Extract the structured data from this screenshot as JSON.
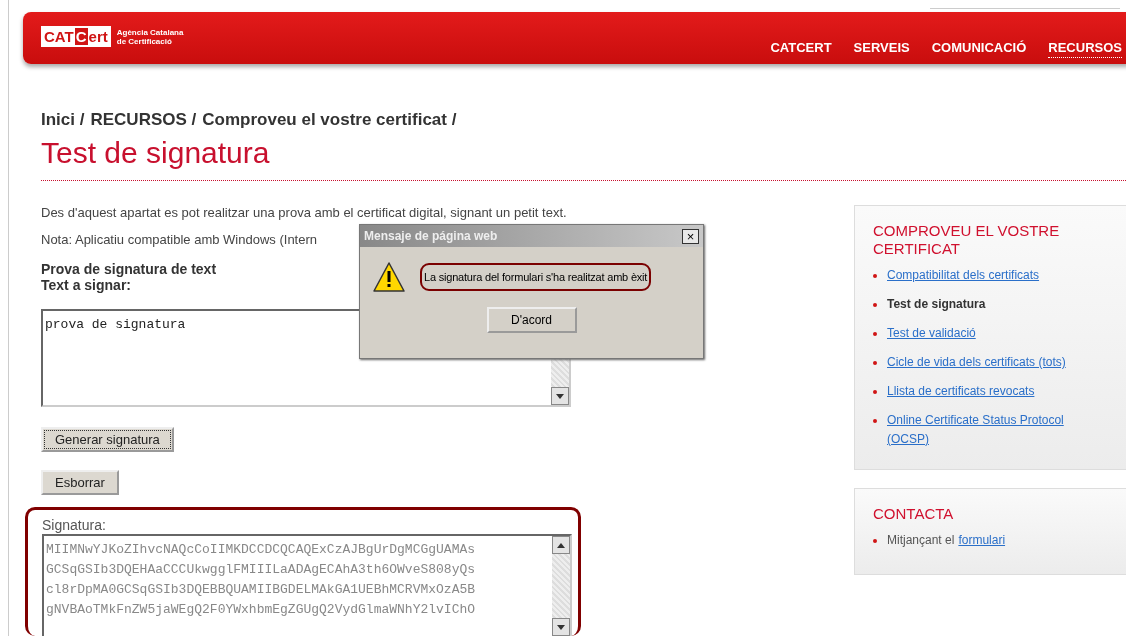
{
  "header": {
    "logo": {
      "mark": [
        "CAT",
        "C",
        "ert"
      ],
      "tagline": [
        "Agència Catalana",
        "de Certificació"
      ]
    },
    "nav": [
      {
        "label": "CATCERT",
        "selected": false
      },
      {
        "label": "SERVEIS",
        "selected": false
      },
      {
        "label": "COMUNICACIÓ",
        "selected": false
      },
      {
        "label": "RECURSOS",
        "selected": true
      }
    ]
  },
  "breadcrumb": [
    "Inici /",
    "RECURSOS /",
    "Comproveu el vostre certificat /"
  ],
  "title": "Test de signatura",
  "intro": [
    "Des d'aquest apartat es pot realitzar una prova amb el certificat digital, signant un petit text.",
    "Nota: Aplicatiu compatible amb Windows (Intern"
  ],
  "form": {
    "heading": "Prova de signatura de text",
    "text_label": "Text a signar:",
    "text_value": "prova de signatura",
    "sign_button": "Generar signatura",
    "clear_button": "Esborrar",
    "signature_label": "Signatura:",
    "signature_lines": [
      "MIIMNwYJKoZIhvcNAQcCoIIMKDCCDCQCAQExCzAJBgUrDgMCGgUAMAs",
      "GCSqGSIb3DQEHAaCCCUkwgglFMIIILaADAgECAhA3th6OWveS808yQs",
      "cl8rDpMA0GCSqGSIb3DQEBBQUAMIIBGDELMAkGA1UEBhMCRVMxOzA5B",
      "gNVBAoTMkFnZW5jaWEgQ2F0YWxhbmEgZGUgQ2VydGlmaWNhY2lvIChO"
    ]
  },
  "sidebar": {
    "title": "COMPROVEU EL VOSTRE CERTIFICAT",
    "items": [
      {
        "label": "Compatibilitat dels certificats",
        "selected": false
      },
      {
        "label": "Test de signatura",
        "selected": true
      },
      {
        "label": "Test de validació",
        "selected": false
      },
      {
        "label": "Cicle de vida dels certificats (tots)",
        "selected": false
      },
      {
        "label": "Llista de certificats revocats",
        "selected": false
      },
      {
        "label": "Online Certificate Status Protocol (OCSP)",
        "selected": false
      }
    ]
  },
  "contact": {
    "title": "CONTACTA",
    "text": "Mitjançant el",
    "link": "formulari"
  },
  "dialog": {
    "title": "Mensaje de página web",
    "close": "×",
    "message": "La signatura del formulari s'ha realitzat amb èxit",
    "ok_button": "D'acord"
  }
}
